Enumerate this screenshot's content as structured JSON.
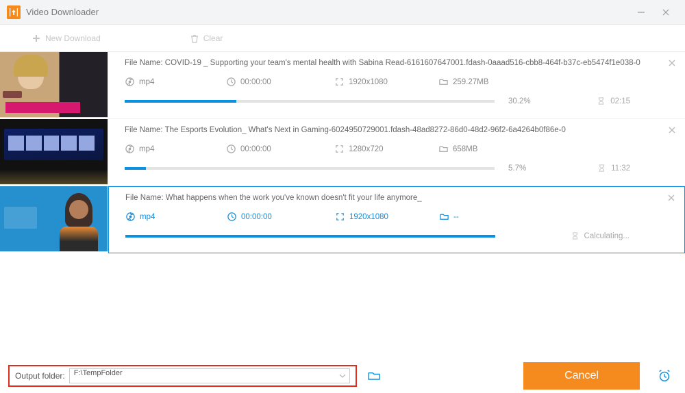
{
  "titlebar": {
    "title": "Video Downloader"
  },
  "toolbar": {
    "new_download_label": "New Download",
    "clear_label": "Clear"
  },
  "items": [
    {
      "filename_prefix": "File Name: ",
      "filename": "COVID-19 _ Supporting your team's mental health with Sabina Read-6161607647001.fdash-0aaad516-cbb8-464f-b37c-eb5474f1e038-0",
      "format": "mp4",
      "duration": "00:00:00",
      "resolution": "1920x1080",
      "filesize": "259.27MB",
      "percent": "30.2%",
      "eta": "02:15",
      "progress_pct": 30.2,
      "selected": false,
      "thumb_colors": {
        "bg": "#2b2530",
        "accent": "#d6186f",
        "person_bg": "#c9a57a"
      }
    },
    {
      "filename_prefix": "File Name: ",
      "filename": "The Esports Evolution_ What's Next in Gaming-6024950729001.fdash-48ad8272-86d0-48d2-96f2-6a4264b0f86e-0",
      "format": "mp4",
      "duration": "00:00:00",
      "resolution": "1280x720",
      "filesize": "658MB",
      "percent": "5.7%",
      "eta": "11:32",
      "progress_pct": 5.7,
      "selected": false,
      "thumb_colors": {
        "bg": "#0a0b0e",
        "accent": "#0a2a6b",
        "stage": "#1b2f7d"
      }
    },
    {
      "filename_prefix": "File Name: ",
      "filename": "What happens when the work you've known doesn't fit your life anymore_",
      "format": "mp4",
      "duration": "00:00:00",
      "resolution": "1920x1080",
      "filesize": "--",
      "percent": "",
      "eta": "Calculating...",
      "progress_pct": 100,
      "selected": true,
      "thumb_colors": {
        "bg": "#1f7fbe",
        "accent": "#e88a34",
        "person": "#2b2b2b"
      }
    }
  ],
  "bottom": {
    "output_label": "Output folder:",
    "output_path": "F:\\TempFolder",
    "cancel_label": "Cancel"
  }
}
